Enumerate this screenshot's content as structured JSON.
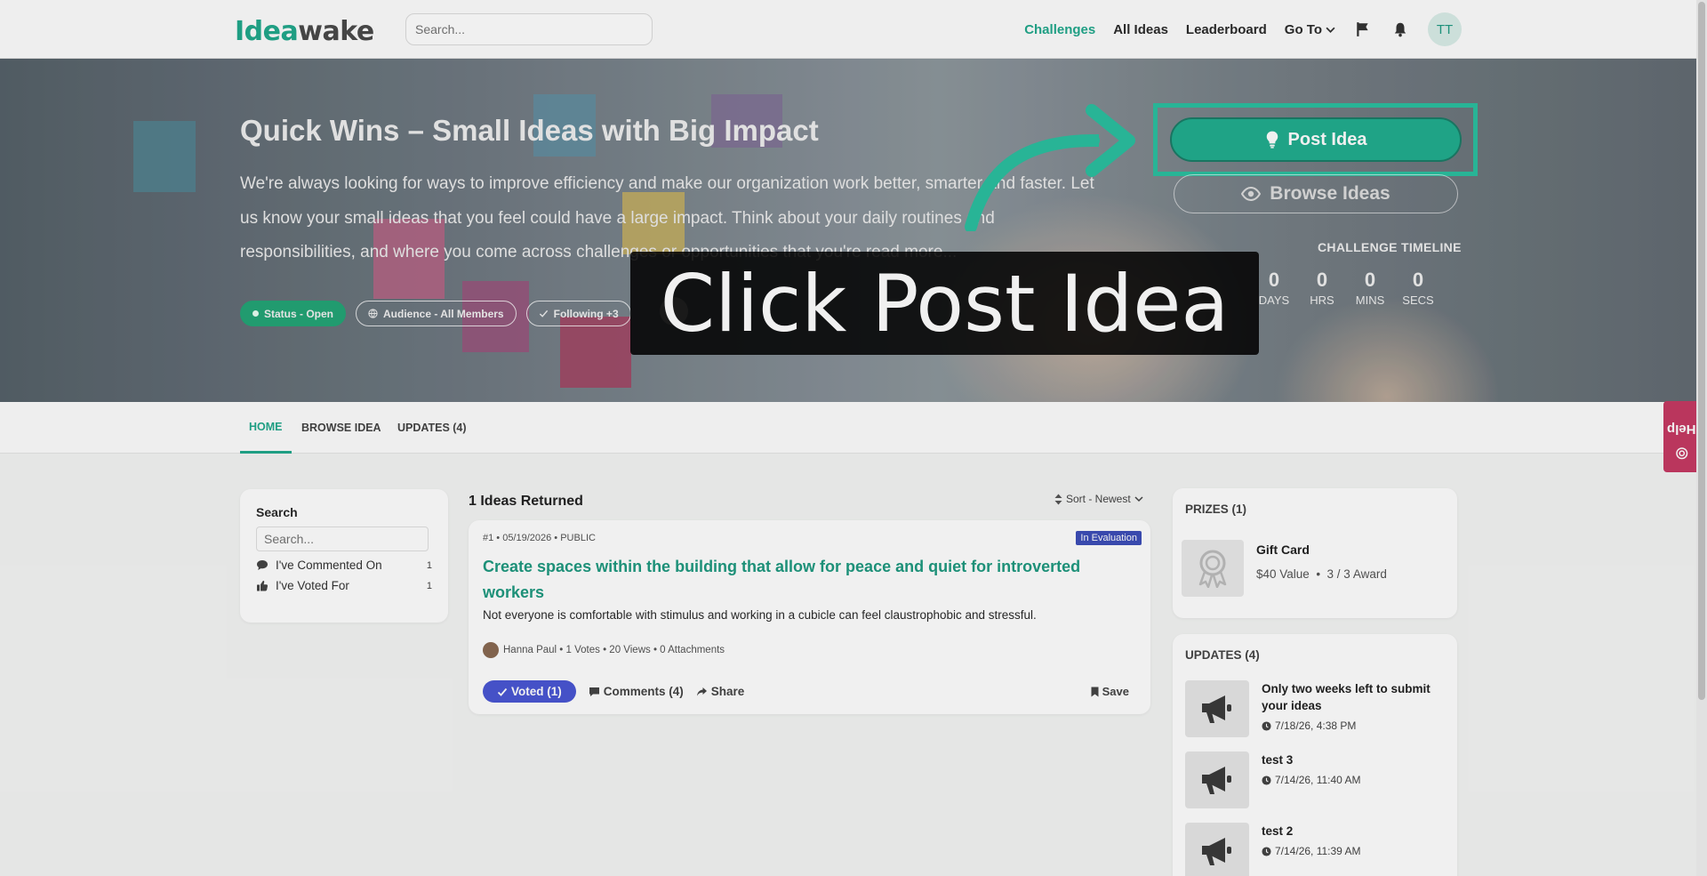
{
  "app": {
    "logo_part1": "Idea",
    "logo_part2": "wake"
  },
  "topbar": {
    "search_placeholder": "Search...",
    "nav": [
      "Challenges",
      "All Ideas",
      "Leaderboard",
      "Go To"
    ],
    "avatar_initials": "TT"
  },
  "hero": {
    "title": "Quick Wins – Small Ideas with Big Impact",
    "description": "We're always looking for ways to improve efficiency and make our organization work better, smarter and faster. Let us know your small ideas that you feel could have a large impact. Think about your daily routines and responsibilities, and where you come across challenges or opportunities that you're read more...",
    "chips": {
      "status": "Status - Open",
      "audience": "Audience - All Members",
      "following": "Following +3"
    },
    "post_button": "Post Idea",
    "browse_button": "Browse Ideas",
    "timeline_title": "CHALLENGE TIMELINE",
    "timer": [
      {
        "value": "0",
        "unit": "DAYS"
      },
      {
        "value": "0",
        "unit": "HRS"
      },
      {
        "value": "0",
        "unit": "MINS"
      },
      {
        "value": "0",
        "unit": "SECS"
      }
    ]
  },
  "tutorial": {
    "caption": "Click Post Idea",
    "highlight_color": "#2bc0a0"
  },
  "tabs": [
    "HOME",
    "BROWSE IDEA",
    "UPDATES (4)"
  ],
  "search_panel": {
    "title": "Search",
    "placeholder": "Search...",
    "filters": [
      {
        "label": "I've Commented On",
        "count": "1"
      },
      {
        "label": "I've Voted For",
        "count": "1"
      }
    ]
  },
  "ideas": {
    "count_label": "1 Ideas Returned",
    "sort_label": "Sort - Newest",
    "items": [
      {
        "meta": "#1 • 05/19/2026 • PUBLIC",
        "badge": "In Evaluation",
        "title": "Create spaces within the building that allow for peace and quiet for introverted workers",
        "description": "Not everyone is comfortable with stimulus and working in a cubicle can feel claustrophobic and stressful.",
        "author_line": "Hanna Paul • 1 Votes • 20 Views • 0 Attachments",
        "voted_label": "Voted (1)",
        "comments_label": "Comments (4)",
        "share_label": "Share",
        "save_label": "Save"
      }
    ]
  },
  "prizes": {
    "title": "PRIZES (1)",
    "items": [
      {
        "name": "Gift Card",
        "value": "$40 Value",
        "award": "3 / 3 Award"
      }
    ]
  },
  "updates": {
    "title": "UPDATES (4)",
    "items": [
      {
        "title": "Only two weeks left to submit your ideas",
        "date": "7/18/26, 4:38 PM"
      },
      {
        "title": "test 3",
        "date": "7/14/26, 11:40 AM"
      },
      {
        "title": "test 2",
        "date": "7/14/26, 11:39 AM"
      }
    ]
  },
  "help": {
    "label": "Help"
  },
  "colors": {
    "brand": "#21a88c",
    "voted": "#4a57d4",
    "badge": "#3d4eb8",
    "help": "#c63a63"
  }
}
